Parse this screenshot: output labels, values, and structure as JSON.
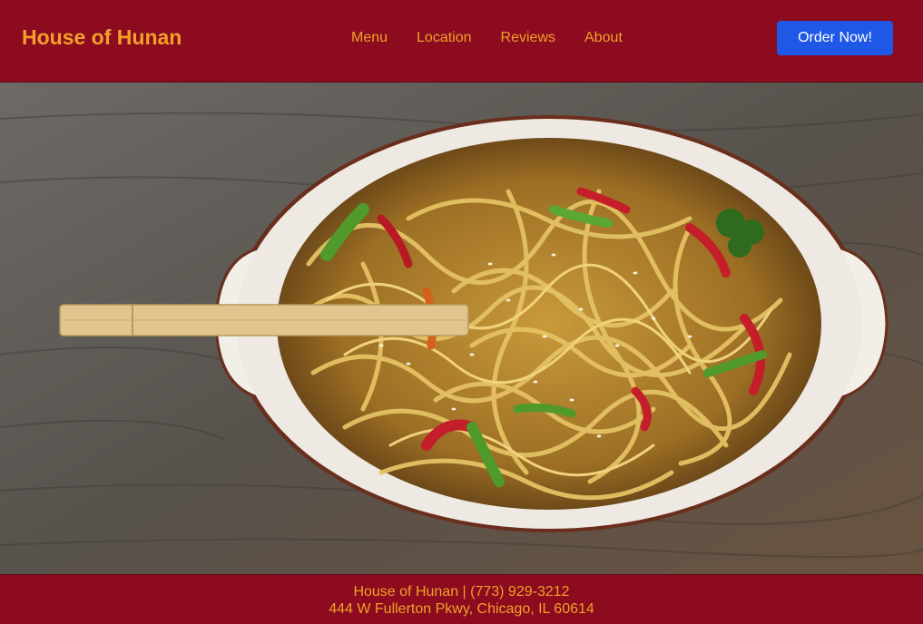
{
  "header": {
    "brand": "House of Hunan",
    "nav": [
      {
        "label": "Menu"
      },
      {
        "label": "Location"
      },
      {
        "label": "Reviews"
      },
      {
        "label": "About"
      }
    ],
    "order_button": "Order Now!"
  },
  "hero": {
    "image": "noodle-bowl-photo"
  },
  "footer": {
    "line1": "House of Hunan | (773) 929-3212",
    "line2": "444 W Fullerton Pkwy, Chicago, IL 60614"
  },
  "colors": {
    "header_bg": "#8c0b1e",
    "accent_text": "#f1a12a",
    "button_bg": "#1f57e6"
  }
}
